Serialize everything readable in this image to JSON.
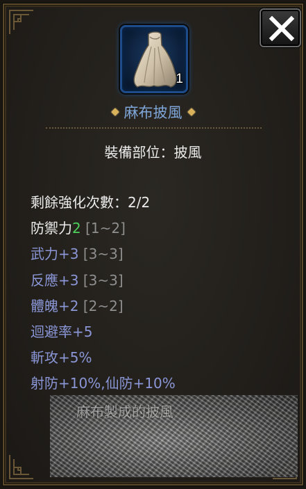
{
  "close_button": {
    "icon": "close-icon"
  },
  "item": {
    "icon": "cloak-icon",
    "count": "1",
    "name": "麻布披風",
    "name_color": "#7ea6d9"
  },
  "equip_slot": {
    "label": "裝備部位：",
    "value": "披風"
  },
  "stats": {
    "upgrades": {
      "label": "剩餘強化次數：",
      "value": "2/2"
    },
    "defense": {
      "label": "防禦力",
      "value": "2",
      "range": "[1~2]"
    },
    "martial": {
      "label": "武力+3",
      "range": "[3~3]"
    },
    "reaction": {
      "label": "反應+3",
      "range": "[3~3]"
    },
    "physique": {
      "label": "體魄+2",
      "range": "[2~2]"
    },
    "evasion": {
      "label": "迴避率+5"
    },
    "slash": {
      "label": "斬攻+5%"
    },
    "resist": {
      "label": "射防+10%,仙防+10%"
    }
  },
  "background_scene": {
    "text": "麻布製成的披風"
  },
  "colors": {
    "stat_blue": "#8a96d6",
    "stat_white": "#ececec",
    "defense_value_green": "#4cd05a",
    "range_gray": "#8f8f8f",
    "frame_gold": "#5c4a2c",
    "slot_blue": "#1e4c8a"
  }
}
